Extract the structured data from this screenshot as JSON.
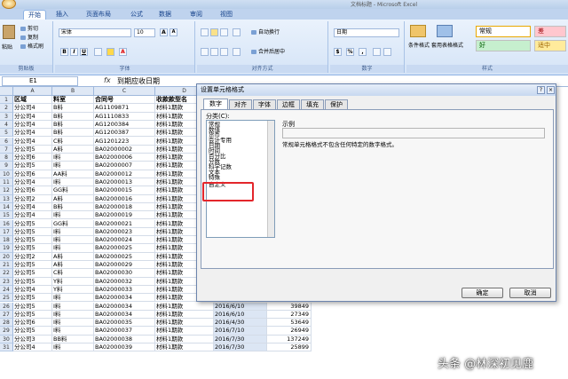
{
  "window": {
    "title": "文档标题 - Microsoft Excel"
  },
  "tabs": [
    "开始",
    "插入",
    "页面布局",
    "公式",
    "数据",
    "审阅",
    "视图"
  ],
  "ribbon": {
    "clipboard": {
      "paste": "粘贴",
      "cut": "剪切",
      "copy": "复制",
      "format_painter": "格式刷",
      "label": "剪贴板"
    },
    "font": {
      "name": "宋体",
      "size": "10",
      "grow": "A",
      "shrink": "A",
      "bold": "B",
      "italic": "I",
      "underline": "U",
      "label": "字体"
    },
    "alignment": {
      "wrap": "自动换行",
      "merge": "合并后居中",
      "label": "对齐方式"
    },
    "number": {
      "format": "日期",
      "currency": "$",
      "percent": "%",
      "comma": ",",
      "label": "数字"
    },
    "styles": {
      "conditional": "条件格式",
      "table": "套用表格格式",
      "normal": "常规",
      "bad": "差",
      "good": "好",
      "neutral": "适中",
      "label": "样式"
    }
  },
  "formula_bar": {
    "cell": "E1",
    "fx": "fx",
    "content": "到期应收日期"
  },
  "columns": [
    "A",
    "B",
    "C",
    "D",
    "E"
  ],
  "rows": [
    [
      "区域",
      "料室",
      "合同号",
      "收款款型名",
      ""
    ],
    [
      "分公司4",
      "B料",
      "AG1109871",
      "材料1期款",
      ""
    ],
    [
      "分公司4",
      "B料",
      "AG1110833",
      "材料1期款",
      ""
    ],
    [
      "分公司4",
      "B料",
      "AG1200384",
      "材料1期款",
      ""
    ],
    [
      "分公司4",
      "B料",
      "AG1200387",
      "材料1期款",
      ""
    ],
    [
      "分公司4",
      "C料",
      "AG1201223",
      "材料1期款",
      ""
    ],
    [
      "分公司5",
      "A料",
      "BA02000002",
      "材料1期款",
      ""
    ],
    [
      "分公司6",
      "I料",
      "BA02000006",
      "材料1期款",
      ""
    ],
    [
      "分公司5",
      "I料",
      "BA02000007",
      "材料1期款",
      ""
    ],
    [
      "分公司6",
      "AA料",
      "BA02000012",
      "材料1期款",
      ""
    ],
    [
      "分公司4",
      "I料",
      "BA02000013",
      "材料1期款",
      ""
    ],
    [
      "分公司6",
      "GG料",
      "BA02000015",
      "材料1期款",
      ""
    ],
    [
      "分公司2",
      "A料",
      "BA02000016",
      "材料1期款",
      ""
    ],
    [
      "分公司4",
      "B料",
      "BA02000018",
      "材料1期款",
      ""
    ],
    [
      "分公司4",
      "I料",
      "BA02000019",
      "材料1期款",
      ""
    ],
    [
      "分公司5",
      "GG料",
      "BA02000021",
      "材料1期款",
      ""
    ],
    [
      "分公司5",
      "I料",
      "BA02000023",
      "材料1期款",
      ""
    ],
    [
      "分公司5",
      "I料",
      "BA02000024",
      "材料1期款",
      ""
    ],
    [
      "分公司5",
      "I料",
      "BA02000025",
      "材料1期款",
      ""
    ],
    [
      "分公司2",
      "A料",
      "BA02000025",
      "材料1期款",
      ""
    ],
    [
      "分公司5",
      "A料",
      "BA02000029",
      "材料1期款",
      ""
    ],
    [
      "分公司5",
      "C料",
      "BA02000030",
      "材料1期款",
      ""
    ],
    [
      "分公司5",
      "Y料",
      "BA02000032",
      "材料1期款",
      "2016/6/10"
    ],
    [
      "分公司4",
      "Y料",
      "BA02000033",
      "材料1期款",
      "2016/6/10"
    ],
    [
      "分公司5",
      "I料",
      "BA02000034",
      "材料1期款",
      "2016/6/10"
    ],
    [
      "分公司5",
      "I料",
      "BA02000034",
      "材料1期款",
      "2016/6/10"
    ],
    [
      "分公司5",
      "I料",
      "BA02000034",
      "材料1期款",
      "2016/6/10"
    ],
    [
      "分公司6",
      "I料",
      "BA02000035",
      "材料1期款",
      "2016/4/30"
    ],
    [
      "分公司5",
      "I料",
      "BA02000037",
      "材料1期款",
      "2016/7/10"
    ],
    [
      "分公司3",
      "BB料",
      "BA02000038",
      "材料1期款",
      "2016/7/30"
    ],
    [
      "分公司4",
      "I料",
      "BA02000039",
      "材料1期款",
      "2016/7/30"
    ]
  ],
  "numbers_col_f": [
    "31649",
    "26649",
    "39849",
    "39849",
    "27349",
    "53649",
    "26949",
    "137249",
    "25899"
  ],
  "dialog": {
    "title": "设置单元格格式",
    "tabs": [
      "数字",
      "对齐",
      "字体",
      "边框",
      "填充",
      "保护"
    ],
    "category_label": "分类(C):",
    "categories": [
      "常规",
      "数值",
      "货币",
      "会计专用",
      "日期",
      "时间",
      "百分比",
      "分数",
      "科学记数",
      "文本",
      "特殊",
      "自定义"
    ],
    "sample_label": "示例",
    "description": "常规单元格格式不包含任何特定的数字格式。",
    "ok": "确定",
    "cancel": "取消"
  },
  "watermark": "头条 @林深初见鹿"
}
